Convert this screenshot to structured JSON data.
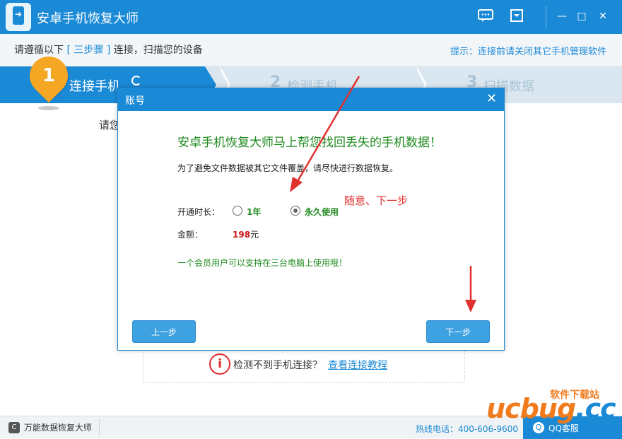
{
  "app": {
    "title": "安卓手机恢复大师"
  },
  "titlebar": {
    "feedback_icon": "chat-bubble-icon",
    "menu_icon": "dropdown-icon",
    "minimize": "—",
    "maximize": "□",
    "close": "✕"
  },
  "hint": {
    "left_prefix": "请遵循以下",
    "left_steps": "[ 三步骤 ]",
    "left_suffix": "连接，扫描您的设备",
    "right": "提示：连接前请关闭其它手机管理软件"
  },
  "steps": [
    {
      "num": "1",
      "label": "连接手机"
    },
    {
      "num": "2",
      "label": "检测手机"
    },
    {
      "num": "3",
      "label": "扫描数据"
    }
  ],
  "background": {
    "partial_text": "请您",
    "warning_text": "检测不到手机连接？",
    "warning_link": "查看连接教程"
  },
  "statusbar": {
    "left_label": "万能数据恢复大师",
    "phone": "热线电话：400-606-9600",
    "qq": "QQ客服"
  },
  "watermark": {
    "site": "软件下载站",
    "brand_a": "ucbug",
    "brand_b": ".cc"
  },
  "dialog": {
    "title": "账号",
    "close": "✕",
    "headline": "安卓手机恢复大师马上帮您找回丢失的手机数据！",
    "subline": "为了避免文件数据被其它文件覆盖，请尽快进行数据恢复。",
    "duration_label": "开通时长：",
    "options": [
      {
        "label": "1年",
        "checked": false
      },
      {
        "label": "永久使用",
        "checked": true
      }
    ],
    "amount_label": "金额：",
    "amount_value": "198",
    "amount_unit": "元",
    "note": "一个会员用户可以支持在三台电脑上使用哦！",
    "annotation": "随意、下一步",
    "prev_button": "上一步",
    "next_button": "下一步"
  },
  "colors": {
    "primary": "#1a89d6",
    "accent": "#f5a623",
    "green_text": "#1f8a1f",
    "red_text": "#e0312f"
  }
}
